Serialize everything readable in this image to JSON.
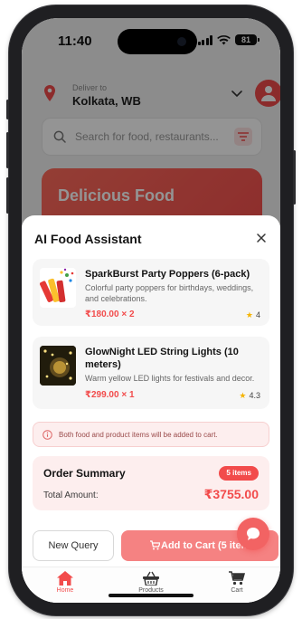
{
  "status_bar": {
    "time": "11:40",
    "battery": "81"
  },
  "header": {
    "deliver_label": "Deliver to",
    "city": "Kolkata, WB"
  },
  "search": {
    "placeholder": "Search for food, restaurants..."
  },
  "banner": {
    "title": "Delicious Food"
  },
  "modal": {
    "title": "AI Food Assistant",
    "items": [
      {
        "name": "SparkBurst Party Poppers (6-pack)",
        "description": "Colorful party poppers for birthdays, weddings, and celebrations.",
        "price": "₹180.00 × 2",
        "rating": "4"
      },
      {
        "name": "GlowNight LED String Lights (10 meters)",
        "description": "Warm yellow LED lights for festivals and decor.",
        "price": "₹299.00 × 1",
        "rating": "4.3"
      }
    ],
    "notice": "Both food and product items will be added to cart.",
    "summary": {
      "title": "Order Summary",
      "badge": "5 items",
      "total_label": "Total Amount:",
      "total_value": "₹3755.00"
    },
    "buttons": {
      "new_query": "New Query",
      "add_to_cart": "Add to Cart (5 items"
    }
  },
  "tabbar": [
    {
      "label": "Home",
      "icon": "home-icon",
      "active": true
    },
    {
      "label": "Products",
      "icon": "basket-icon",
      "active": false
    },
    {
      "label": "Cart",
      "icon": "cart-icon",
      "active": false
    }
  ],
  "colors": {
    "accent": "#f24b4b",
    "accent_light": "#f58282"
  }
}
